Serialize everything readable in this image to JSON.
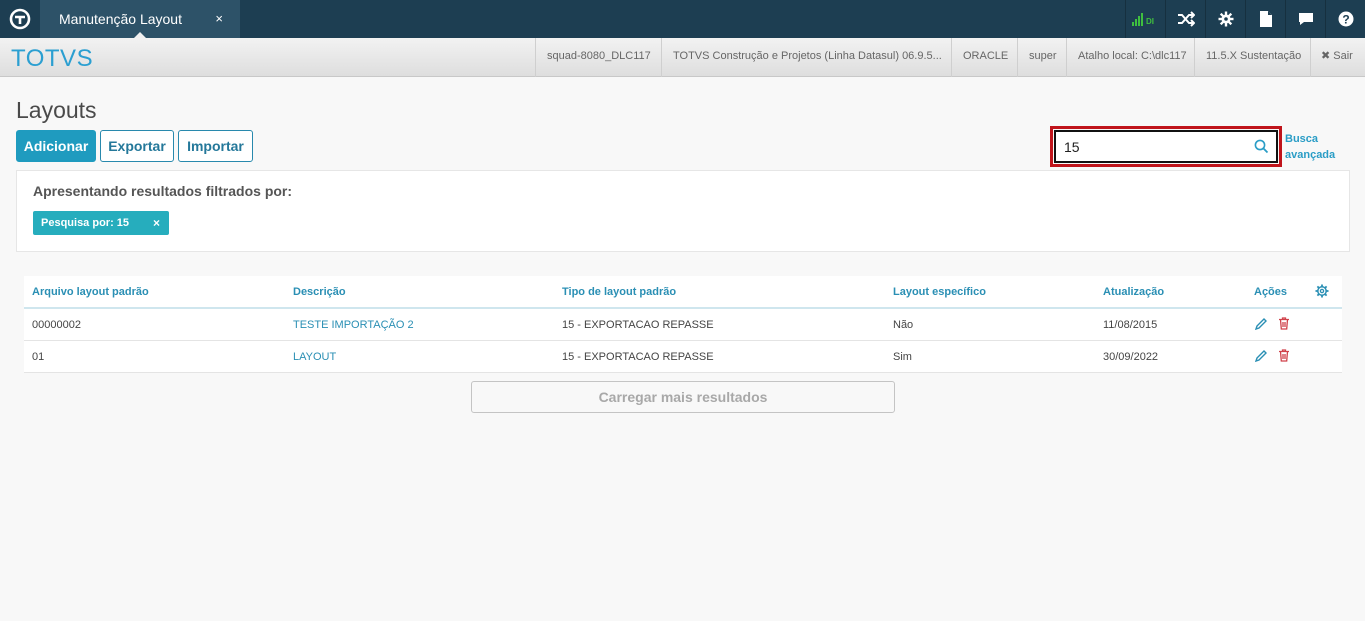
{
  "topbar": {
    "tab_title": "Manutenção Layout",
    "tab_close": "×",
    "signal_label": "DI",
    "icons": [
      "app-logo-icon",
      "signal-icon",
      "shuffle-icon",
      "gear-icon",
      "document-icon",
      "chat-icon",
      "help-icon"
    ]
  },
  "infobar": {
    "brand": "TOTVS",
    "cells": [
      "squad-8080_DLC117",
      "TOTVS Construção e Projetos (Linha Datasul) 06.9.5...",
      "ORACLE",
      "super",
      "Atalho local: C:\\dlc117",
      "11.5.X Sustentação",
      "✖ Sair"
    ]
  },
  "page": {
    "title": "Layouts",
    "buttons": {
      "add": "Adicionar",
      "export": "Exportar",
      "import": "Importar"
    },
    "search": {
      "value": "15",
      "placeholder": ""
    },
    "advanced_search": "Busca avançada"
  },
  "filter": {
    "title": "Apresentando resultados filtrados por:",
    "chip": "Pesquisa por: 15",
    "chip_close": "×"
  },
  "table": {
    "headers": [
      "Arquivo layout padrão",
      "Descrição",
      "Tipo de layout padrão",
      "Layout específico",
      "Atualização",
      "Ações"
    ],
    "rows": [
      {
        "file": "00000002",
        "description": "TESTE IMPORTAÇÃO 2",
        "type": "15 - EXPORTACAO REPASSE",
        "specific": "Não",
        "updated": "11/08/2015"
      },
      {
        "file": "01",
        "description": "LAYOUT",
        "type": "15 - EXPORTACAO REPASSE",
        "specific": "Sim",
        "updated": "30/09/2022"
      }
    ],
    "load_more": "Carregar mais resultados"
  },
  "colors": {
    "topbar": "#1d3e52",
    "accent": "#1f9bbf",
    "link": "#2a8fb4",
    "chip": "#26adbd",
    "highlight": "#c0141b",
    "delete": "#d0424a",
    "signal": "#3fbf3f"
  }
}
